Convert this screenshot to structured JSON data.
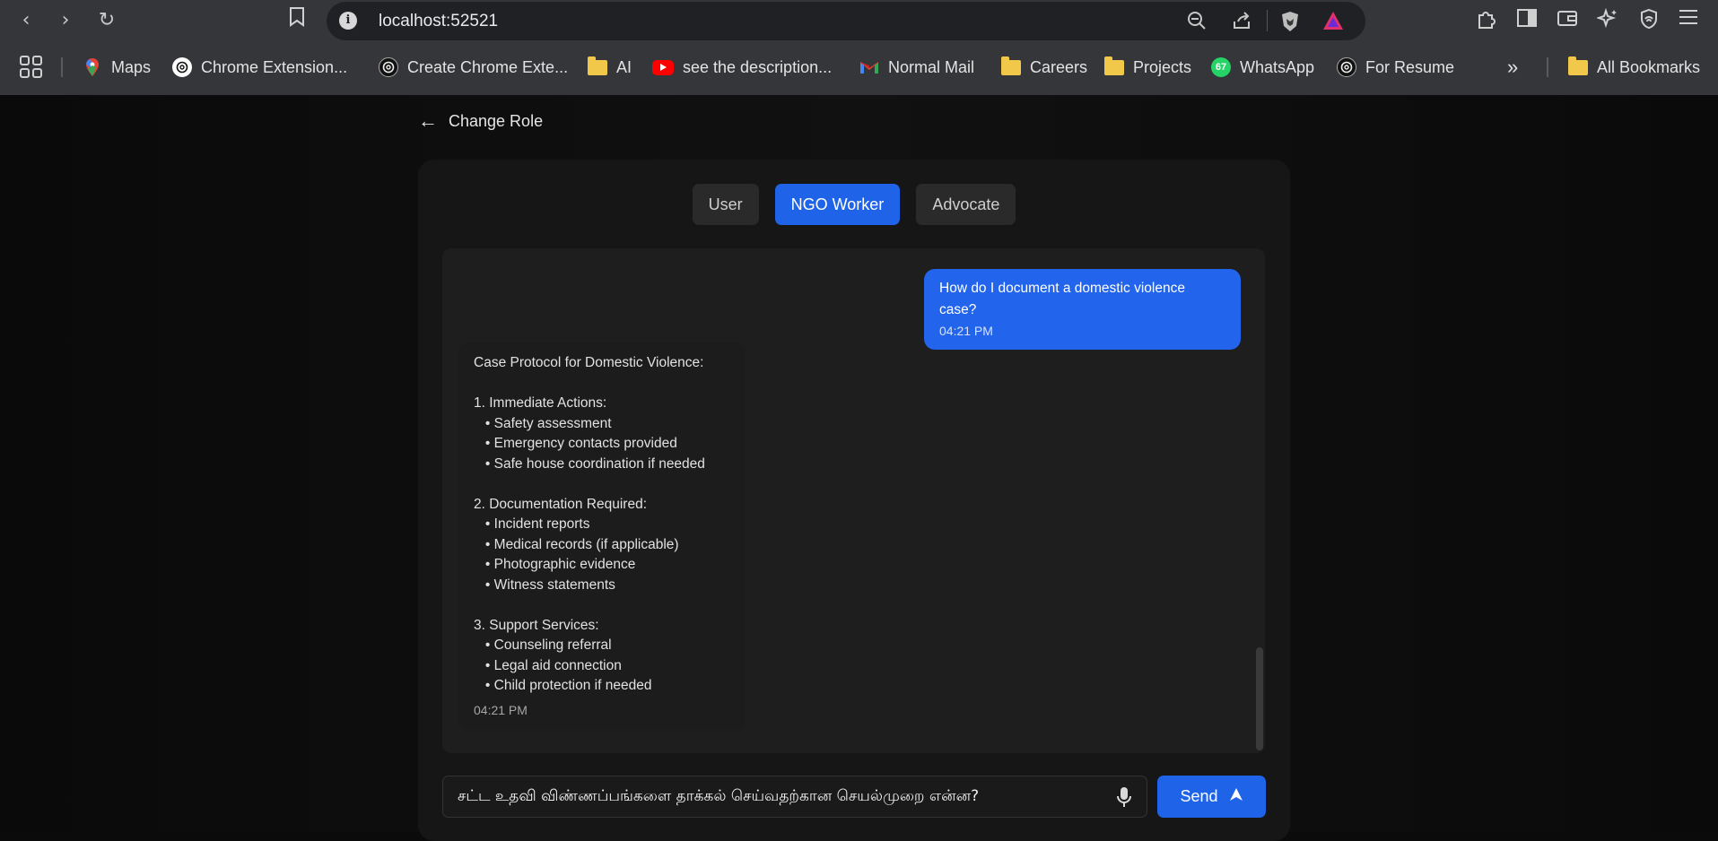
{
  "browser": {
    "url": "localhost:52521",
    "bookmarks": [
      {
        "label": "Maps",
        "icon": "maps-icon"
      },
      {
        "label": "Chrome Extension...",
        "icon": "openai-icon"
      },
      {
        "label": "Create Chrome Exte...",
        "icon": "openai-icon"
      },
      {
        "label": "AI",
        "icon": "folder-icon"
      },
      {
        "label": "see the description...",
        "icon": "youtube-icon"
      },
      {
        "label": "Normal Mail",
        "icon": "gmail-icon"
      },
      {
        "label": "Careers",
        "icon": "folder-icon"
      },
      {
        "label": "Projects",
        "icon": "folder-icon"
      },
      {
        "label": "WhatsApp",
        "icon": "whatsapp-icon"
      },
      {
        "label": "For Resume",
        "icon": "openai-icon"
      }
    ],
    "all_bookmarks": "All Bookmarks",
    "whatsapp_badge": "67"
  },
  "page": {
    "back_label": "Change Role",
    "roles": [
      "User",
      "NGO Worker",
      "Advocate"
    ],
    "active_role": "NGO Worker",
    "messages": {
      "user": {
        "text": "How do I document a domestic violence case?",
        "time": "04:21 PM"
      },
      "bot": {
        "lines": [
          "Case Protocol for Domestic Violence:",
          "",
          "1. Immediate Actions:",
          "   • Safety assessment",
          "   • Emergency contacts provided",
          "   • Safe house coordination if needed",
          "",
          "2. Documentation Required:",
          "   • Incident reports",
          "   • Medical records (if applicable)",
          "   • Photographic evidence",
          "   • Witness statements",
          "",
          "3. Support Services:",
          "   • Counseling referral",
          "   • Legal aid connection",
          "   • Child protection if needed"
        ],
        "time": "04:21 PM"
      }
    },
    "input_value": "சட்ட உதவி விண்ணப்பங்களை தாக்கல் செய்வதற்கான செயல்முறை என்ன?",
    "send_label": "Send"
  },
  "colors": {
    "accent": "#1f63e8",
    "user_bubble": "#2264eb",
    "panel_bg": "#161616",
    "chat_bg": "#1e1e1e"
  }
}
